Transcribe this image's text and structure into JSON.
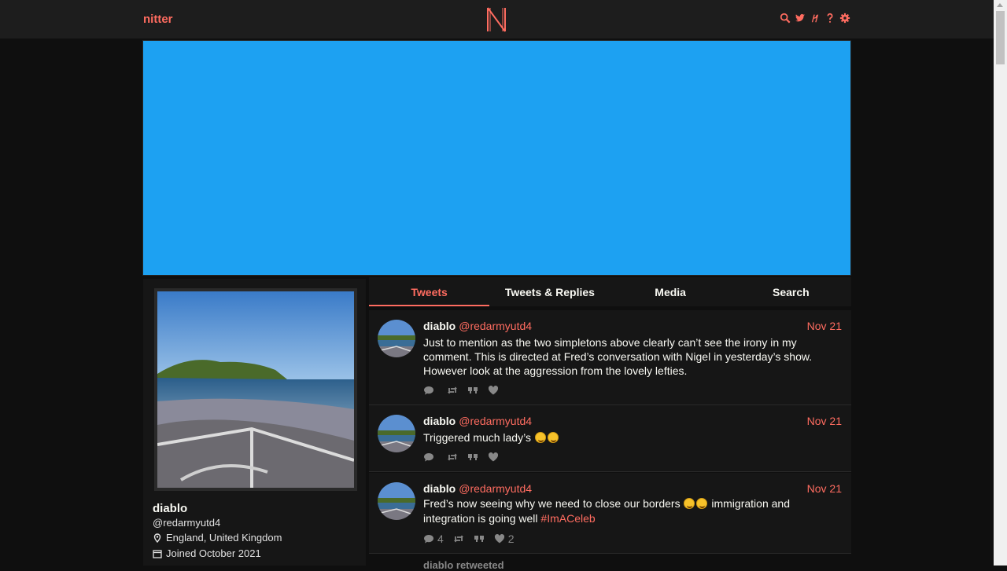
{
  "nav": {
    "brand": "nitter",
    "icons": [
      "search-icon",
      "twitter-bird-icon",
      "rss-icon",
      "help-icon",
      "settings-gear-icon"
    ]
  },
  "colors": {
    "accent": "#ff6c60",
    "banner": "#1da1f2",
    "background": "#0f0f0f",
    "panel": "#161616"
  },
  "profile": {
    "name": "diablo",
    "handle": "@redarmyutd4",
    "location": "England, United Kingdom",
    "joined": "Joined October 2021"
  },
  "tabs": [
    {
      "label": "Tweets",
      "active": true
    },
    {
      "label": "Tweets & Replies",
      "active": false
    },
    {
      "label": "Media",
      "active": false
    },
    {
      "label": "Search",
      "active": false
    }
  ],
  "tweets": [
    {
      "fullname": "diablo",
      "username": "@redarmyutd4",
      "date": "Nov 21",
      "text": "Just to mention as the two simpletons above clearly can’t see the irony in my comment. This is directed at Fred’s conversation with Nigel in yesterday’s show. However look at the aggression from the lovely lefties.",
      "replies": "",
      "likes": ""
    },
    {
      "fullname": "diablo",
      "username": "@redarmyutd4",
      "date": "Nov 21",
      "text": "Triggered much lady’s",
      "replies": "",
      "likes": ""
    },
    {
      "fullname": "diablo",
      "username": "@redarmyutd4",
      "date": "Nov 21",
      "text_before": "Fred’s now seeing why we need to close our borders",
      "text_after": "immigration and integration is going well",
      "hashtag": "#ImACeleb",
      "replies": "4",
      "likes": "2"
    }
  ],
  "next_hint": "diablo retweeted"
}
